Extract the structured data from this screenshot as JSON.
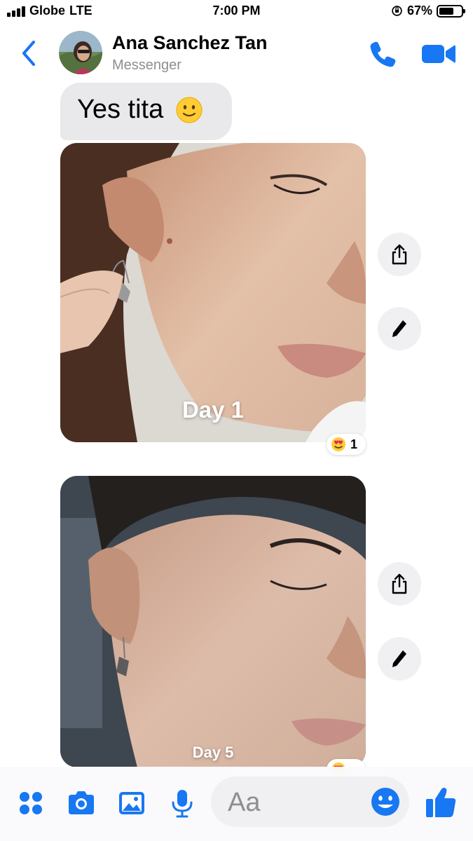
{
  "status_bar": {
    "carrier": "Globe",
    "network": "LTE",
    "time": "7:00 PM",
    "battery_percent": "67%",
    "battery_level": 0.67
  },
  "header": {
    "contact_name": "Ana Sanchez Tan",
    "subtitle": "Messenger",
    "icons": [
      "back-chevron-icon",
      "phone-icon",
      "video-camera-icon"
    ]
  },
  "messages": [
    {
      "type": "text",
      "text": "Yes tita",
      "emoji": "slightly-smiling-face"
    },
    {
      "type": "image",
      "caption": "Day 1",
      "reaction_emoji": "heart-eyes",
      "reaction_count": "1"
    },
    {
      "type": "image",
      "caption": "Day 5",
      "reaction_emoji": "heart-eyes"
    }
  ],
  "composer": {
    "placeholder": "Aa",
    "icons": [
      "apps-grid-icon",
      "camera-icon",
      "photo-gallery-icon",
      "microphone-icon",
      "emoji-icon",
      "thumbs-up-icon"
    ]
  },
  "colors": {
    "accent": "#1877f2",
    "bubble_incoming": "#e9e9eb",
    "subtitle_gray": "#8e8e93"
  }
}
